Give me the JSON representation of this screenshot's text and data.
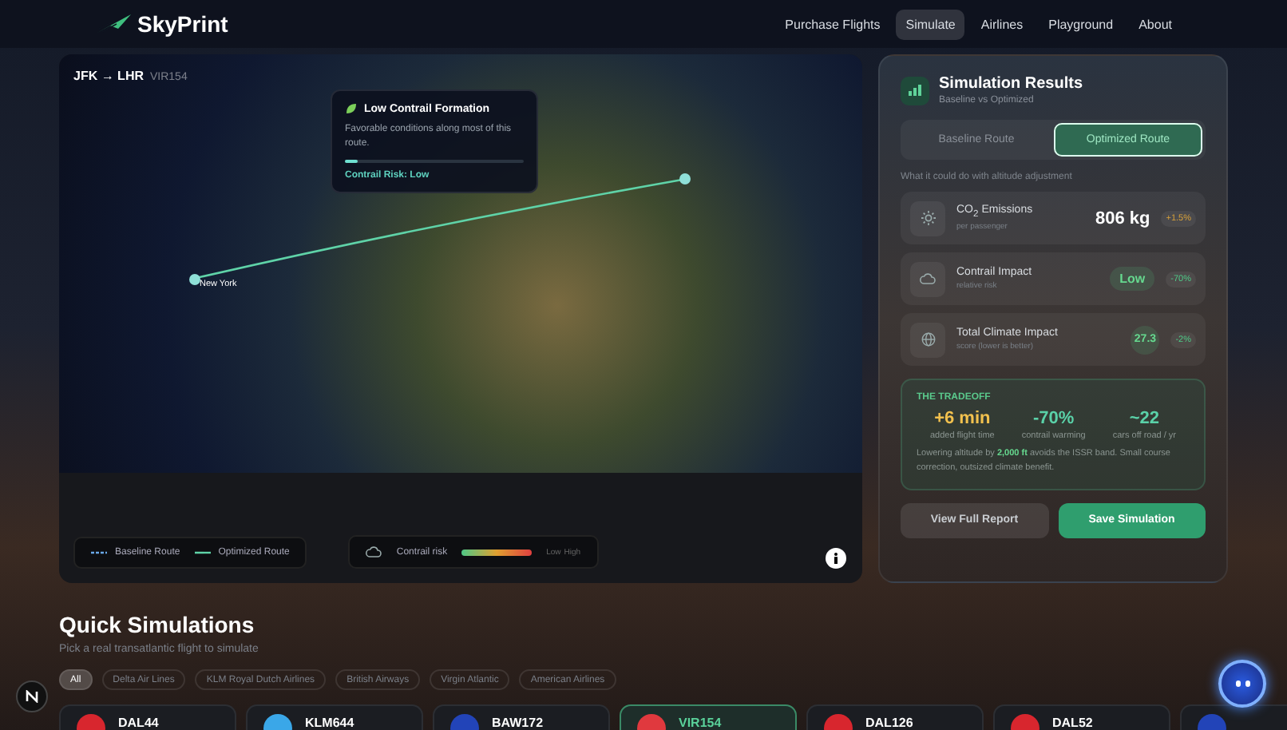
{
  "brand": {
    "name": "SkyPrint"
  },
  "nav": [
    {
      "label": "Purchase Flights",
      "selected": false
    },
    {
      "label": "Simulate",
      "selected": true
    },
    {
      "label": "Airlines",
      "selected": false
    },
    {
      "label": "Playground",
      "selected": false
    },
    {
      "label": "About",
      "selected": false
    }
  ],
  "map": {
    "route": "JFK → LHR",
    "flight": "VIR154",
    "origin": "New York",
    "tooltip": {
      "title": "Low Contrail Formation",
      "text": "Favorable conditions along most of this route.",
      "level": 0.07,
      "risk": "Contrail Risk: Low"
    },
    "legend": [
      {
        "label": "Baseline Route",
        "kind": "dashed"
      },
      {
        "label": "Optimized Route",
        "kind": "solid"
      }
    ],
    "risk_scale": {
      "label": "Contrail risk",
      "low": "Low",
      "high": "High"
    }
  },
  "results": {
    "title": "Simulation Results",
    "subtitle": "Baseline vs Optimized",
    "tabs": [
      {
        "label": "Baseline Route",
        "selected": false
      },
      {
        "label": "Optimized Route",
        "selected": true
      }
    ],
    "hint": "What it could do with altitude adjustment",
    "metrics": [
      {
        "title": "CO$_{2}$ Emissions",
        "sub": "per passenger",
        "value": "806 kg",
        "kind": "plain",
        "badge": "+1.5%",
        "color": "#d9a23a"
      },
      {
        "title": "Contrail Impact",
        "sub": "relative risk",
        "value": "Low",
        "kind": "pill",
        "badge": "-70%",
        "color": "#4fc987"
      },
      {
        "title": "Total Climate Impact",
        "sub": "score (lower is better)",
        "value": "27.3",
        "kind": "circle",
        "badge": "-2%",
        "color": "#4fc987"
      }
    ],
    "tradeoff": {
      "title": "THE TRADEOFF",
      "stats": [
        {
          "value": "+6 min",
          "label": "added flight time",
          "color": "#f2c14e"
        },
        {
          "value": "-70%",
          "label": "contrail warming",
          "color": "#5ad1a8"
        },
        {
          "value": "~22",
          "label": "cars off road / yr",
          "color": "#5ad1a8"
        }
      ],
      "text": "Lowering altitude by **2,000 ft** avoids the ISSR band. Small course correction, outsized climate benefit."
    },
    "buttons": [
      {
        "label": "View Full Report",
        "kind": "secondary"
      },
      {
        "label": "Save Simulation",
        "kind": "primary"
      }
    ]
  },
  "quick": {
    "title": "Quick Simulations",
    "subtitle": "Pick a real transatlantic flight to simulate",
    "filters": [
      {
        "label": "All",
        "selected": true
      },
      {
        "label": "Delta Air Lines",
        "selected": false
      },
      {
        "label": "KLM Royal Dutch Airlines",
        "selected": false
      },
      {
        "label": "British Airways",
        "selected": false
      },
      {
        "label": "Virgin Atlantic",
        "selected": false
      },
      {
        "label": "American Airlines",
        "selected": false
      }
    ],
    "flights": [
      {
        "code": "DAL44",
        "color": "#d8262e",
        "selected": false
      },
      {
        "code": "KLM644",
        "color": "#3aa7e8",
        "selected": false
      },
      {
        "code": "BAW172",
        "color": "#2244b8",
        "selected": false
      },
      {
        "code": "VIR154",
        "color": "#e0393e",
        "selected": true
      },
      {
        "code": "DAL126",
        "color": "#d8262e",
        "selected": false
      },
      {
        "code": "DAL52",
        "color": "#d8262e",
        "selected": false
      },
      {
        "color": "#2244b8",
        "selected": false
      }
    ]
  }
}
